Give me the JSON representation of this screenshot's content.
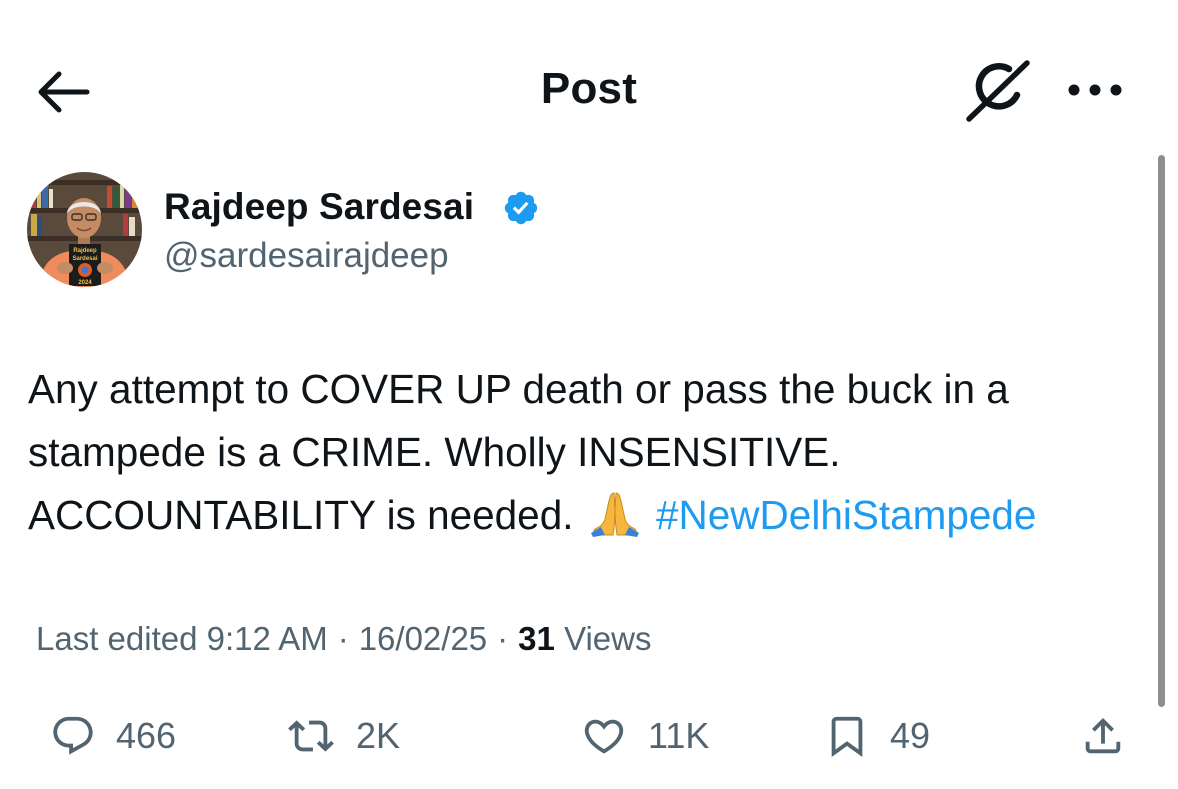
{
  "header": {
    "title": "Post",
    "icons": {
      "back": "back-arrow-icon",
      "grok": "grok-icon",
      "more": "more-options-icon"
    }
  },
  "author": {
    "name": "Rajdeep Sardesai",
    "handle": "@sardesairajdeep",
    "verified": true,
    "avatar": {
      "book_title": "Rajdeep Sardesai",
      "book_year": "2024"
    }
  },
  "post": {
    "lines": [
      "Any attempt to COVER UP death or pass the buck in a",
      "stampede is a CRIME. Wholly INSENSITIVE.",
      "ACCOUNTABILITY is needed."
    ],
    "emoji": "folded-hands",
    "hashtag": "#NewDelhiStampede"
  },
  "meta": {
    "edited_label": "Last edited 9:12 AM",
    "separator": "·",
    "date": "16/02/25",
    "views_count": "31",
    "views_label": "Views"
  },
  "actions": {
    "replies": "466",
    "reposts": "2K",
    "likes": "11K",
    "bookmarks": "49"
  },
  "colors": {
    "text": "#0f1419",
    "secondary": "#536471",
    "accent": "#1d9bf0",
    "background": "#ffffff"
  }
}
